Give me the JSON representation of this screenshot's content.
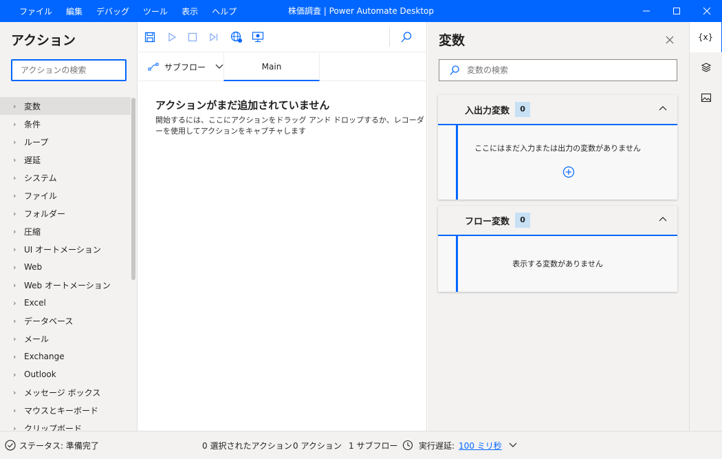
{
  "window": {
    "title": "株価調査 | Power Automate Desktop",
    "menu": [
      "ファイル",
      "編集",
      "デバッグ",
      "ツール",
      "表示",
      "ヘルプ"
    ]
  },
  "actions_panel": {
    "title": "アクション",
    "search_placeholder": "アクションの検索",
    "items": [
      {
        "label": "変数"
      },
      {
        "label": "条件"
      },
      {
        "label": "ループ"
      },
      {
        "label": "遅延"
      },
      {
        "label": "システム"
      },
      {
        "label": "ファイル"
      },
      {
        "label": "フォルダー"
      },
      {
        "label": "圧縮"
      },
      {
        "label": "UI オートメーション"
      },
      {
        "label": "Web"
      },
      {
        "label": "Web オートメーション"
      },
      {
        "label": "Excel"
      },
      {
        "label": "データベース"
      },
      {
        "label": "メール"
      },
      {
        "label": "Exchange"
      },
      {
        "label": "Outlook"
      },
      {
        "label": "メッセージ ボックス"
      },
      {
        "label": "マウスとキーボード"
      },
      {
        "label": "クリップボード"
      }
    ]
  },
  "flow": {
    "subflow_label": "サブフロー",
    "main_tab": "Main",
    "empty_title": "アクションがまだ追加されていません",
    "empty_desc": "開始するには、ここにアクションをドラッグ アンド ドロップするか、レコーダーを使用してアクションをキャプチャします"
  },
  "variables": {
    "title": "変数",
    "search_placeholder": "変数の検索",
    "io": {
      "label": "入出力変数",
      "count": "0",
      "empty": "ここにはまだ入力または出力の変数がありません"
    },
    "flow": {
      "label": "フロー変数",
      "count": "0",
      "empty": "表示する変数がありません"
    }
  },
  "rail": {
    "vars_label": "{x}"
  },
  "status": {
    "state": "ステータス: 準備完了",
    "selected": "0 選択されたアクション",
    "actions": "0 アクション",
    "subflows": "1 サブフロー",
    "delay_label": "実行遅延:",
    "delay_value": "100 ミリ秒"
  },
  "colors": {
    "accent": "#0066ff",
    "panel": "#f3f2f1"
  }
}
